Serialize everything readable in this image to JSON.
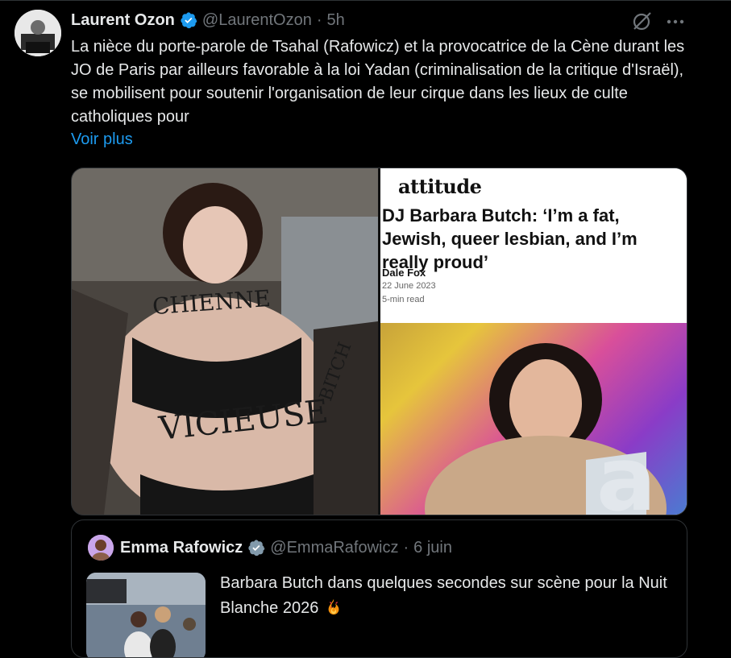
{
  "tweet": {
    "author_name": "Laurent Ozon",
    "author_handle": "@LaurentOzon",
    "separator": "·",
    "time": "5h",
    "text": "La nièce du porte-parole de Tsahal (Rafowicz) et la provocatrice de la Cène durant les JO de Paris par ailleurs favorable à la loi Yadan (criminalisation de la critique d'Israël), se mobilisent pour soutenir l'organisation de leur cirque dans les lieux de culte catholiques pour",
    "see_more": "Voir plus"
  },
  "media": {
    "left_photo_text": "CHIENNE",
    "left_photo_text_2": "VICIEUSE",
    "left_photo_text_3": "BITCH",
    "article": {
      "brand": "attitude",
      "title": "DJ Barbara Butch: ‘I’m a fat, Jewish, queer lesbian, and I’m really proud’",
      "author": "Dale Fox",
      "date": "22 June 2023",
      "read_time": "5-min read"
    }
  },
  "quoted": {
    "author_name": "Emma Rafowicz",
    "author_handle": "@EmmaRafowicz",
    "separator": "·",
    "time": "6 juin",
    "text": "Barbara Butch dans quelques secondes sur scène pour la Nuit Blanche 2026"
  },
  "colors": {
    "background": "#000000",
    "text": "#e7e9ea",
    "secondary": "#71767b",
    "link": "#1d9bf0",
    "verified": "#1d9bf0",
    "verified_gray": "#829aab",
    "border": "#2f3336"
  },
  "icons": [
    "grok-icon",
    "more-icon",
    "verified-badge-icon",
    "fire-emoji-icon"
  ]
}
